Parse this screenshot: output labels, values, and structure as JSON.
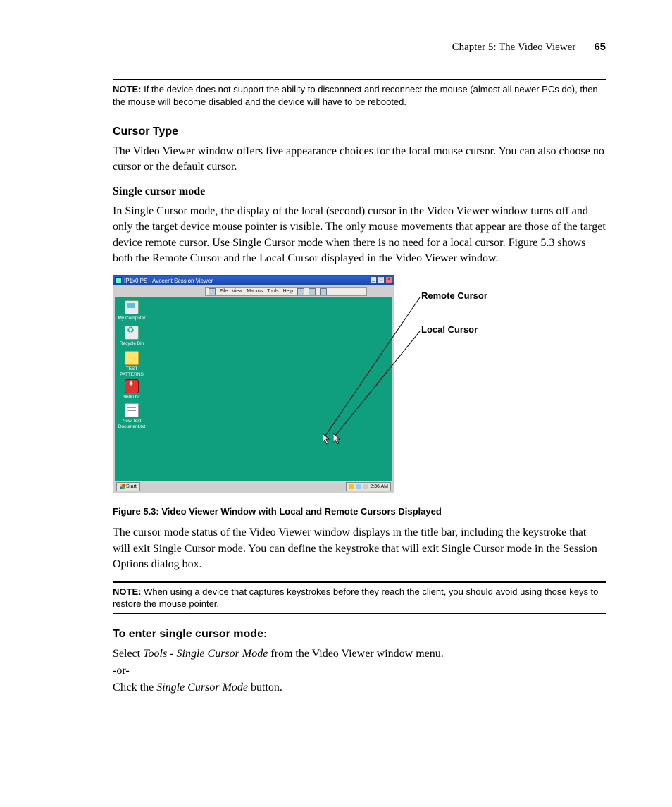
{
  "header": {
    "chapter": "Chapter 5: The Video Viewer",
    "page_no": "65"
  },
  "note1": {
    "label": "NOTE:",
    "text": "If the device does not support the ability to disconnect and reconnect the mouse (almost all newer PCs do), then the mouse will become disabled and the device will have to be rebooted."
  },
  "h_cursor_type": "Cursor Type",
  "p_cursor_type": "The Video Viewer window offers five appearance choices for the local mouse cursor. You can also choose no cursor or the default cursor.",
  "h_single_cursor": "Single cursor mode",
  "p_single_cursor": "In Single Cursor mode, the display of the local (second) cursor in the Video Viewer window turns off and only the target device mouse pointer is visible. The only mouse movements that appear are those of the target device remote cursor. Use Single Cursor mode when there is no need for a local cursor. Figure 5.3 shows both the Remote Cursor and the Local Cursor displayed in the Video Viewer window.",
  "figure": {
    "window_title": "IP1x0IPS - Avocent Session Viewer",
    "menus": [
      "File",
      "View",
      "Macros",
      "Tools",
      "Help"
    ],
    "icons": {
      "my_computer": "My Computer",
      "recycle_bin": "Recycle Bin",
      "test_patterns": "TEST PATTERNS",
      "file_bit": "9600.bit",
      "new_text": "New Text Document.txt"
    },
    "start_label": "Start",
    "clock": "2:36 AM",
    "annot_remote": "Remote Cursor",
    "annot_local": "Local Cursor",
    "caption": "Figure 5.3: Video Viewer Window with Local and Remote Cursors Displayed"
  },
  "p_after_fig": "The cursor mode status of the Video Viewer window displays in the title bar, including the keystroke that will exit Single Cursor mode. You can define the keystroke that will exit Single Cursor mode in the Session Options dialog box.",
  "note2": {
    "label": "NOTE:",
    "text": "When using a device that captures keystrokes before they reach the client, you should avoid using those keys to restore the mouse pointer."
  },
  "h_enter": "To enter single cursor mode:",
  "enter_steps": {
    "l1a": "Select ",
    "l1b": "Tools - Single Cursor Mode",
    "l1c": " from the Video Viewer window menu.",
    "l2": "-or-",
    "l3a": "Click the ",
    "l3b": "Single Cursor Mode",
    "l3c": " button."
  }
}
